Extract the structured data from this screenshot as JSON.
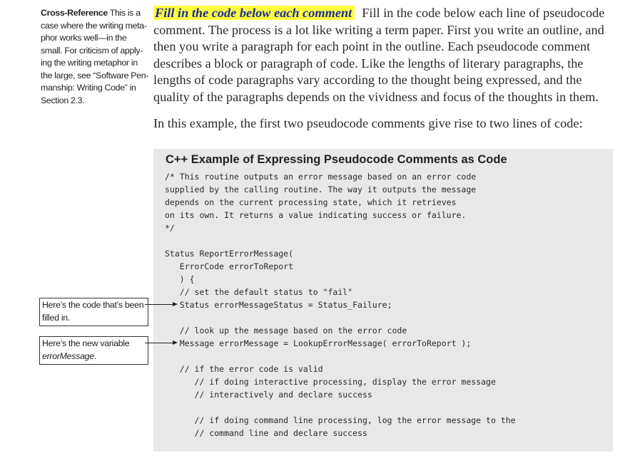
{
  "cross_reference": {
    "label": "Cross-Reference",
    "lines": [
      " This is a",
      "case where the writing meta-",
      "phor works well—in the",
      "small. For criticism of apply-",
      "ing the writing metaphor in",
      "the large, see “Software Pen-",
      "manship: Writing Code” in",
      "Section 2.3."
    ]
  },
  "paragraph1": {
    "heading": "Fill in the code below each comment",
    "first_line_rest": "Fill in the code below each line of pseudocode",
    "lines": [
      "comment. The process is a lot like writing a term paper. First you write an outline, and",
      "then you write a paragraph for each point in the outline. Each pseudocode comment",
      "describes a block or paragraph of code. Like the lengths of literary paragraphs, the",
      "lengths of code paragraphs vary according to the thought being expressed, and the",
      "quality of the paragraphs depends on the vividness and focus of the thoughts in them."
    ]
  },
  "paragraph2": "In this example, the first two pseudocode comments give rise to two lines of code:",
  "code_example": {
    "title": "C++ Example of Expressing Pseudocode Comments as Code",
    "lines": [
      "/* This routine outputs an error message based on an error code",
      "supplied by the calling routine. The way it outputs the message",
      "depends on the current processing state, which it retrieves",
      "on its own. It returns a value indicating success or failure.",
      "*/",
      "",
      "Status ReportErrorMessage(",
      "   ErrorCode errorToReport",
      "   ) {",
      "   // set the default status to \"fail\"",
      "   Status errorMessageStatus = Status_Failure;",
      "",
      "   // look up the message based on the error code",
      "   Message errorMessage = LookupErrorMessage( errorToReport );",
      "",
      "   // if the error code is valid",
      "      // if doing interactive processing, display the error message",
      "      // interactively and declare success",
      "",
      "      // if doing command line processing, log the error message to the",
      "      // command line and declare success"
    ]
  },
  "callouts": [
    {
      "lines": [
        "Here’s the code that’s been",
        "filled in."
      ]
    },
    {
      "line1": "Here’s the new variable",
      "line2_italic": "errorMessage",
      "line2_tail": "."
    }
  ],
  "colors": {
    "highlight": "#ffff3c",
    "heading_text": "#1a2aa0",
    "code_background": "#e8e8e8"
  }
}
